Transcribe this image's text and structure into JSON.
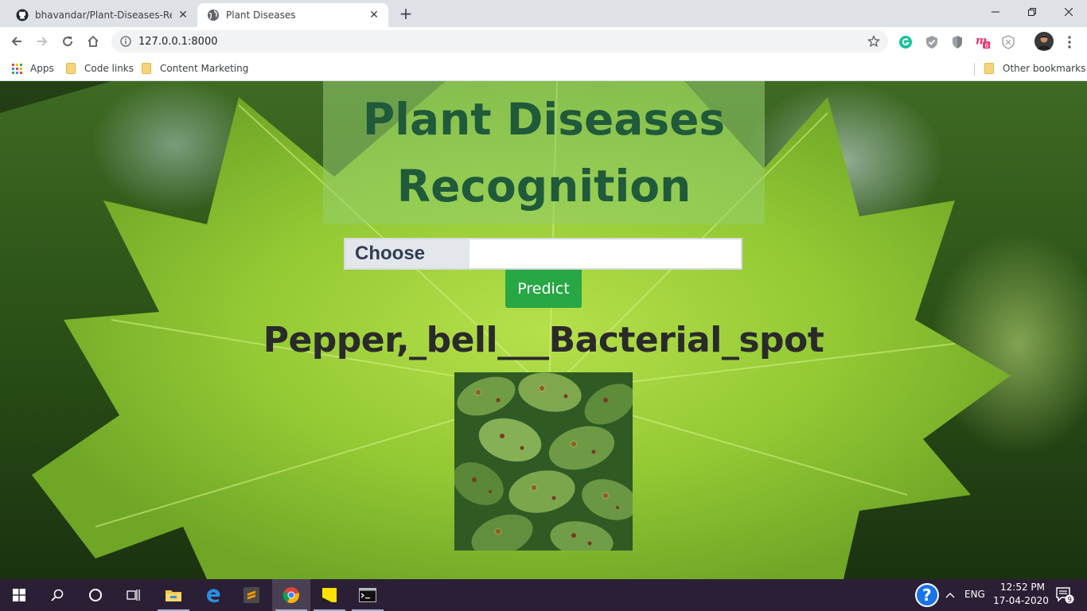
{
  "browser": {
    "tabs": [
      {
        "title": "bhavandar/Plant-Diseases-Recog",
        "favicon": "github-icon"
      },
      {
        "title": "Plant Diseases",
        "favicon": "globe-icon"
      }
    ],
    "url": "127.0.0.1:8000",
    "bookmarks": [
      "Apps",
      "Code links",
      "Content Marketing"
    ],
    "other_bookmarks": "Other bookmarks",
    "extension_badge": "6"
  },
  "page": {
    "title": "Plant Diseases Recognition",
    "choose_label": "Choose",
    "predict_label": "Predict",
    "result": "Pepper,_bell___Bacterial_spot"
  },
  "taskbar": {
    "language": "ENG",
    "time": "12:52 PM",
    "date": "17-04-2020",
    "notifications": "9"
  },
  "colors": {
    "predict_button": "#28a745",
    "title_text": "#1f5a3a",
    "taskbar": "#2b1f35"
  }
}
